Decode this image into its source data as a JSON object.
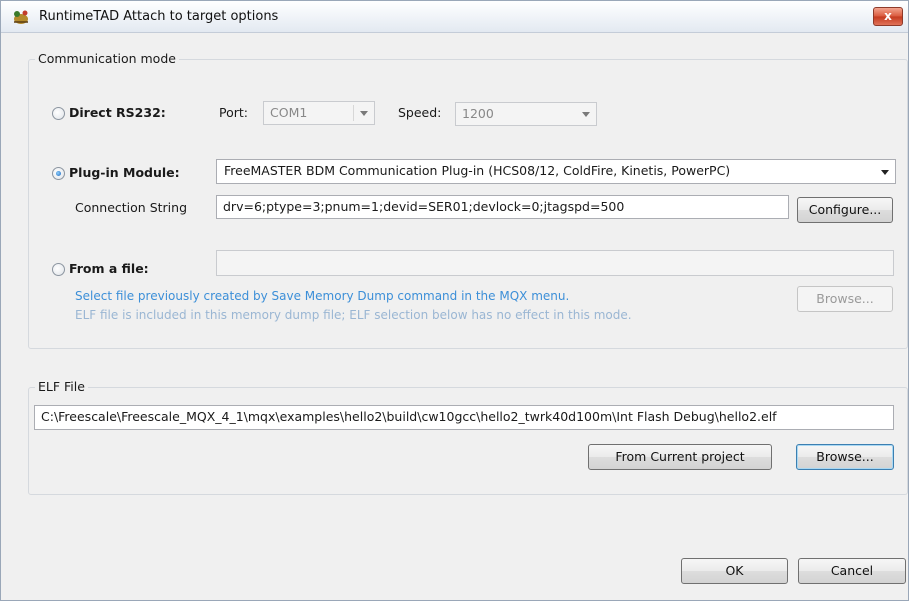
{
  "window": {
    "title": "RuntimeTAD Attach to target options",
    "close_label": "x"
  },
  "communication": {
    "group_title": "Communication mode",
    "direct": {
      "label": "Direct RS232:",
      "port_label": "Port:",
      "port_value": "COM1",
      "speed_label": "Speed:",
      "speed_value": "1200"
    },
    "plugin": {
      "label": "Plug-in Module:",
      "module_value": "FreeMASTER BDM Communication Plug-in (HCS08/12, ColdFire, Kinetis, PowerPC)",
      "connection_label": "Connection String",
      "connection_value": "drv=6;ptype=3;pnum=1;devid=SER01;devlock=0;jtagspd=500",
      "configure_label": "Configure..."
    },
    "file": {
      "label": "From a file:",
      "path_value": "",
      "info_line1": "Select file previously created by Save Memory Dump command in the MQX menu.",
      "info_line2": "ELF file is included in this memory dump file; ELF selection below has no effect in this mode.",
      "browse_label": "Browse..."
    }
  },
  "elf": {
    "group_title": "ELF File",
    "path_value": "C:\\Freescale\\Freescale_MQX_4_1\\mqx\\examples\\hello2\\build\\cw10gcc\\hello2_twrk40d100m\\Int Flash Debug\\hello2.elf",
    "from_project_label": "From Current project",
    "browse_label": "Browse..."
  },
  "footer": {
    "ok_label": "OK",
    "cancel_label": "Cancel"
  },
  "colors": {
    "accent_info": "#3c8fd8",
    "close_red": "#d9583c"
  }
}
